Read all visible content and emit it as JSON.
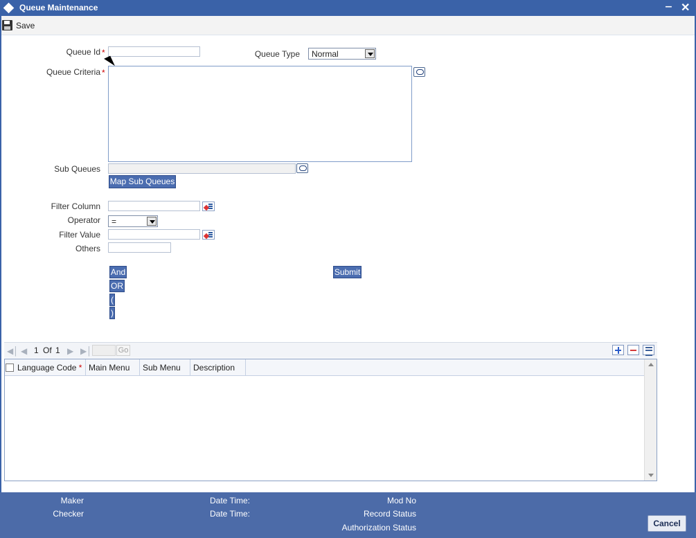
{
  "window": {
    "title": "Queue Maintenance",
    "minimize": "‒",
    "close": "✕"
  },
  "toolbar": {
    "save_label": "Save"
  },
  "form": {
    "queue_id_label": "Queue Id",
    "queue_id_value": "",
    "queue_type_label": "Queue Type",
    "queue_type_value": "Normal",
    "queue_criteria_label": "Queue Criteria",
    "sub_queues_label": "Sub Queues",
    "map_sub_queues_label": "Map Sub Queues",
    "filter_column_label": "Filter Column",
    "operator_label": "Operator",
    "operator_value": "=",
    "filter_value_label": "Filter Value",
    "others_label": "Others",
    "and_label": "And",
    "or_label": "OR",
    "open_paren_label": "(",
    "close_paren_label": ")",
    "submit_label": "Submit",
    "required_mark": "*"
  },
  "grid": {
    "pager": {
      "current": "1",
      "of_label": "Of",
      "total": "1",
      "go_label": "Go"
    },
    "columns": [
      "Language Code",
      "Main Menu",
      "Sub Menu",
      "Description"
    ],
    "rows": []
  },
  "footer": {
    "maker_label": "Maker",
    "checker_label": "Checker",
    "date_time_label_1": "Date Time:",
    "date_time_label_2": "Date Time:",
    "mod_no_label": "Mod No",
    "record_status_label": "Record Status",
    "authorization_status_label": "Authorization Status",
    "cancel_label": "Cancel"
  },
  "colors": {
    "titlebar": "#3a62a8",
    "button": "#4b6db0",
    "footer": "#4c6ba8",
    "required": "#cc0000"
  }
}
